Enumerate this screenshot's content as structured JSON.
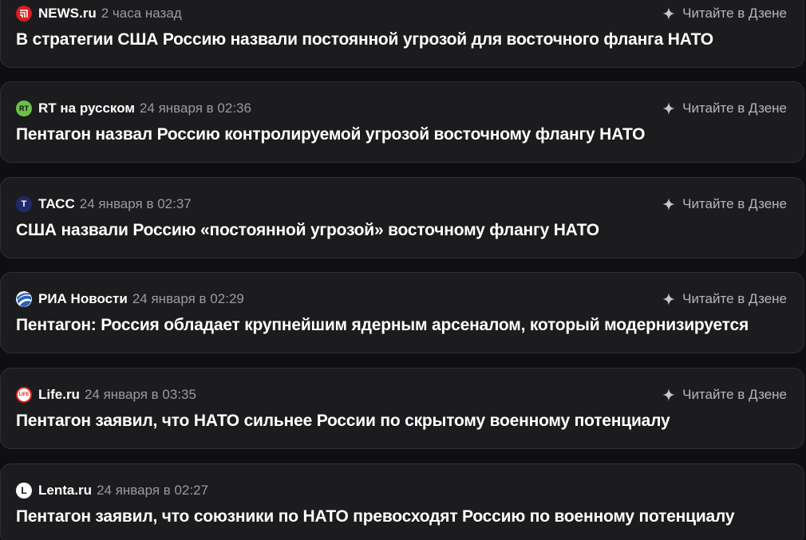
{
  "feed": {
    "read_label": "Читайте в Дзене",
    "items": [
      {
        "source": "NEWS.ru",
        "time": "2 часа назад",
        "icon": "newsru-logo-icon",
        "headline": "В стратегии США Россию назвали постоянной угрозой для восточного фланга НАТО"
      },
      {
        "source": "RT на русском",
        "time": "24 января в 02:36",
        "icon": "rt-logo-icon",
        "logo_text": "RT",
        "headline": "Пентагон назвал Россию контролируемой угрозой восточному флангу НАТО"
      },
      {
        "source": "ТАСС",
        "time": "24 января в 02:37",
        "icon": "tass-logo-icon",
        "logo_text": "Т",
        "headline": "США назвали Россию «постоянной угрозой» восточному флангу НАТО"
      },
      {
        "source": "РИА Новости",
        "time": "24 января в 02:29",
        "icon": "ria-logo-icon",
        "headline": "Пентагон: Россия обладает крупнейшим ядерным арсеналом, который модернизируется"
      },
      {
        "source": "Life.ru",
        "time": "24 января в 03:35",
        "icon": "life-logo-icon",
        "logo_text": "LIFE",
        "headline": "Пентагон заявил, что НАТО сильнее России по скрытому военному потенциалу"
      },
      {
        "source": "Lenta.ru",
        "time": "24 января в 02:27",
        "icon": "lenta-logo-icon",
        "logo_text": "L",
        "headline": "Пентагон заявил, что союзники по НАТО превосходят Россию по военному потенциалу"
      }
    ]
  },
  "colors": {
    "background": "#0f0f11",
    "card": "#1c1c1f",
    "card_border": "#303034",
    "headline": "#ffffff",
    "time": "#9a9aa0",
    "rt_green": "#6cc04a",
    "tass_navy": "#1f2a6b",
    "ria_blue": "#2a63b8",
    "life_red": "#e2231a",
    "newsru_red": "#d6201f"
  }
}
